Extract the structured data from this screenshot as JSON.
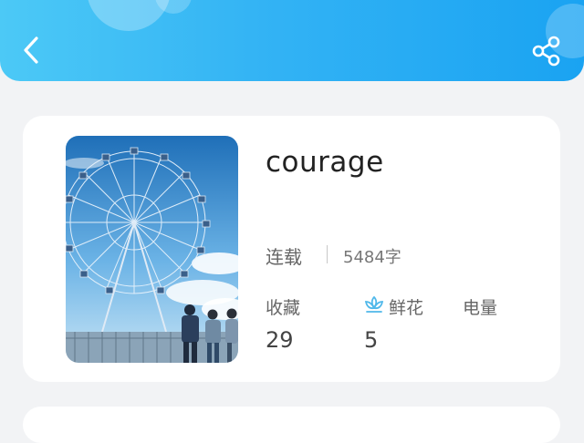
{
  "header": {
    "back_icon": "chevron-left-icon",
    "share_icon": "share-icon",
    "colors": {
      "gradient_start": "#4cc9f6",
      "gradient_end": "#1aa3f2"
    }
  },
  "book": {
    "title": "courage",
    "status": "连载",
    "word_count": "5484字",
    "cover_image": "ferris-wheel-anime-cover"
  },
  "stats": [
    {
      "label": "收藏",
      "value": "29"
    },
    {
      "label": "鲜花",
      "value": "5",
      "icon": "flower-icon"
    },
    {
      "label": "电量",
      "value": ""
    }
  ]
}
